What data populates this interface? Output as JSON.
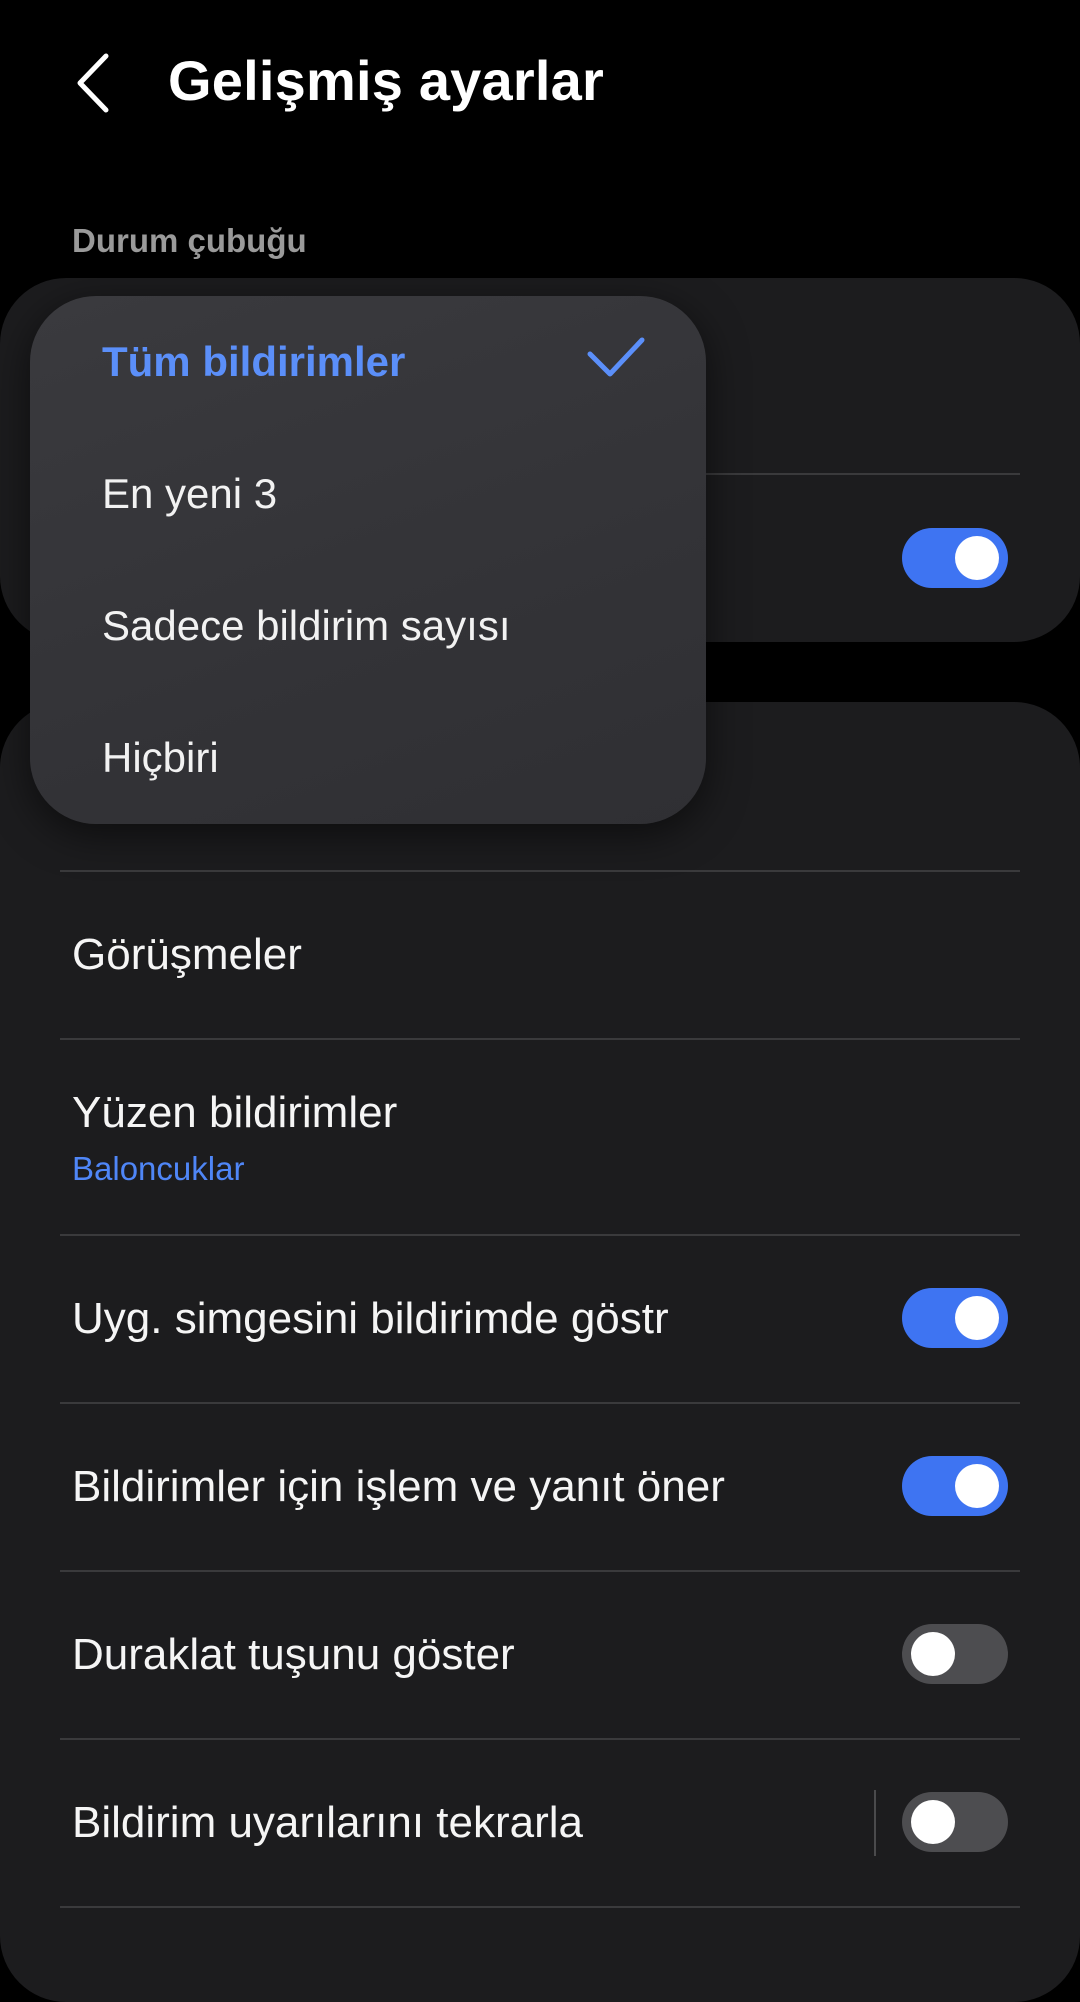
{
  "header": {
    "title": "Gelişmiş ayarlar"
  },
  "section": {
    "status_bar": "Durum çubuğu"
  },
  "dropdown": {
    "options": [
      {
        "label": "Tüm bildirimler",
        "selected": true
      },
      {
        "label": "En yeni 3",
        "selected": false
      },
      {
        "label": "Sadece bildirim sayısı",
        "selected": false
      },
      {
        "label": "Hiçbiri",
        "selected": false
      }
    ]
  },
  "card1": {
    "hidden_row_toggle_on": true
  },
  "settings": {
    "items": [
      {
        "title": "Görüşmeler"
      },
      {
        "title": "Yüzen bildirimler",
        "subtitle": "Baloncuklar"
      },
      {
        "title": "Uyg. simgesini bildirimde göstr",
        "toggle_on": true
      },
      {
        "title": "Bildirimler için işlem ve yanıt öner",
        "toggle_on": true
      },
      {
        "title": "Duraklat tuşunu göster",
        "toggle_on": false
      },
      {
        "title": "Bildirim uyarılarını tekrarla",
        "toggle_on": false
      }
    ]
  },
  "colors": {
    "background": "#000000",
    "card": "#1c1c1e",
    "accent": "#3e74f2",
    "selected_text": "#5b8ff9",
    "secondary_text": "#9a9a9a"
  }
}
